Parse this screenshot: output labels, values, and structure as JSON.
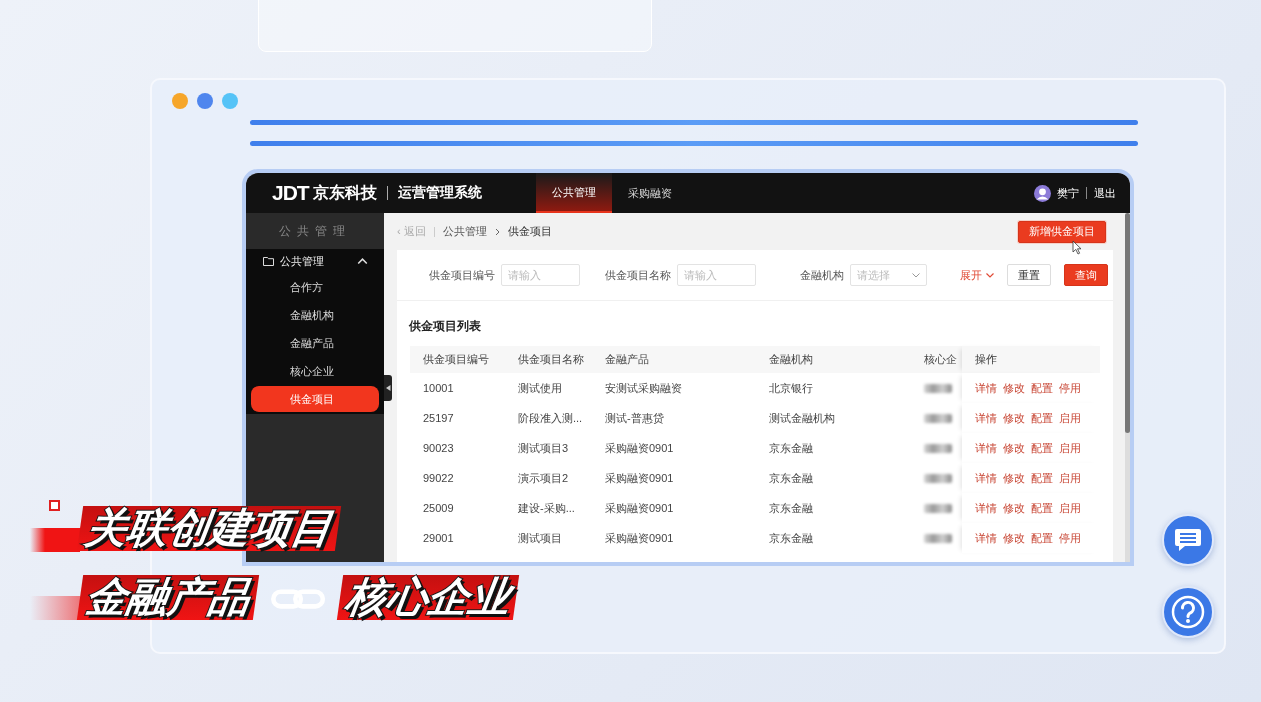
{
  "header": {
    "logo_mark": "JDT",
    "logo_text": "京东科技",
    "system_name": "运营管理系统",
    "tabs": [
      {
        "label": "公共管理",
        "selected": true
      },
      {
        "label": "采购融资",
        "selected": false
      }
    ],
    "user": {
      "name": "樊宁"
    },
    "logout": "退出"
  },
  "sidebar": {
    "title": "公共管理",
    "group": {
      "label": "公共管理",
      "expanded": true,
      "items": [
        {
          "label": "合作方",
          "selected": false
        },
        {
          "label": "金融机构",
          "selected": false
        },
        {
          "label": "金融产品",
          "selected": false
        },
        {
          "label": "核心企业",
          "selected": false
        },
        {
          "label": "供金项目",
          "selected": true
        }
      ]
    }
  },
  "breadcrumb": {
    "back": "‹ 返回",
    "items": [
      "公共管理",
      "供金项目"
    ]
  },
  "add_button": "新增供金项目",
  "filters": [
    {
      "kind": "input",
      "label": "供金项目编号",
      "placeholder": "请输入"
    },
    {
      "kind": "input",
      "label": "供金项目名称",
      "placeholder": "请输入"
    },
    {
      "kind": "select",
      "label": "金融机构",
      "placeholder": "请选择"
    }
  ],
  "expand_link": "展开",
  "reset_button": "重置",
  "search_button": "查询",
  "table": {
    "title": "供金项目列表",
    "columns": [
      "供金项目编号",
      "供金项目名称",
      "金融产品",
      "金融机构",
      "核心企",
      "操作"
    ],
    "rows": [
      {
        "id": "10001",
        "name": "测试使用",
        "product": "安测试采购融资",
        "institution": "北京银行",
        "actions": [
          "详情",
          "修改",
          "配置",
          "停用"
        ]
      },
      {
        "id": "25197",
        "name": "阶段准入测...",
        "product": "测试-普惠贷",
        "institution": "测试金融机构",
        "actions": [
          "详情",
          "修改",
          "配置",
          "启用"
        ]
      },
      {
        "id": "90023",
        "name": "测试项目3",
        "product": "采购融资0901",
        "institution": "京东金融",
        "actions": [
          "详情",
          "修改",
          "配置",
          "启用"
        ]
      },
      {
        "id": "99022",
        "name": "演示项目2",
        "product": "采购融资0901",
        "institution": "京东金融",
        "actions": [
          "详情",
          "修改",
          "配置",
          "启用"
        ]
      },
      {
        "id": "25009",
        "name": "建设-采购...",
        "product": "采购融资0901",
        "institution": "京东金融",
        "actions": [
          "详情",
          "修改",
          "配置",
          "启用"
        ]
      },
      {
        "id": "29001",
        "name": "测试项目",
        "product": "采购融资0901",
        "institution": "京东金融",
        "actions": [
          "详情",
          "修改",
          "配置",
          "停用"
        ]
      }
    ]
  },
  "caption": {
    "line1": "关联创建项目",
    "line2_left": "金融产品",
    "line2_right": "核心企业"
  }
}
